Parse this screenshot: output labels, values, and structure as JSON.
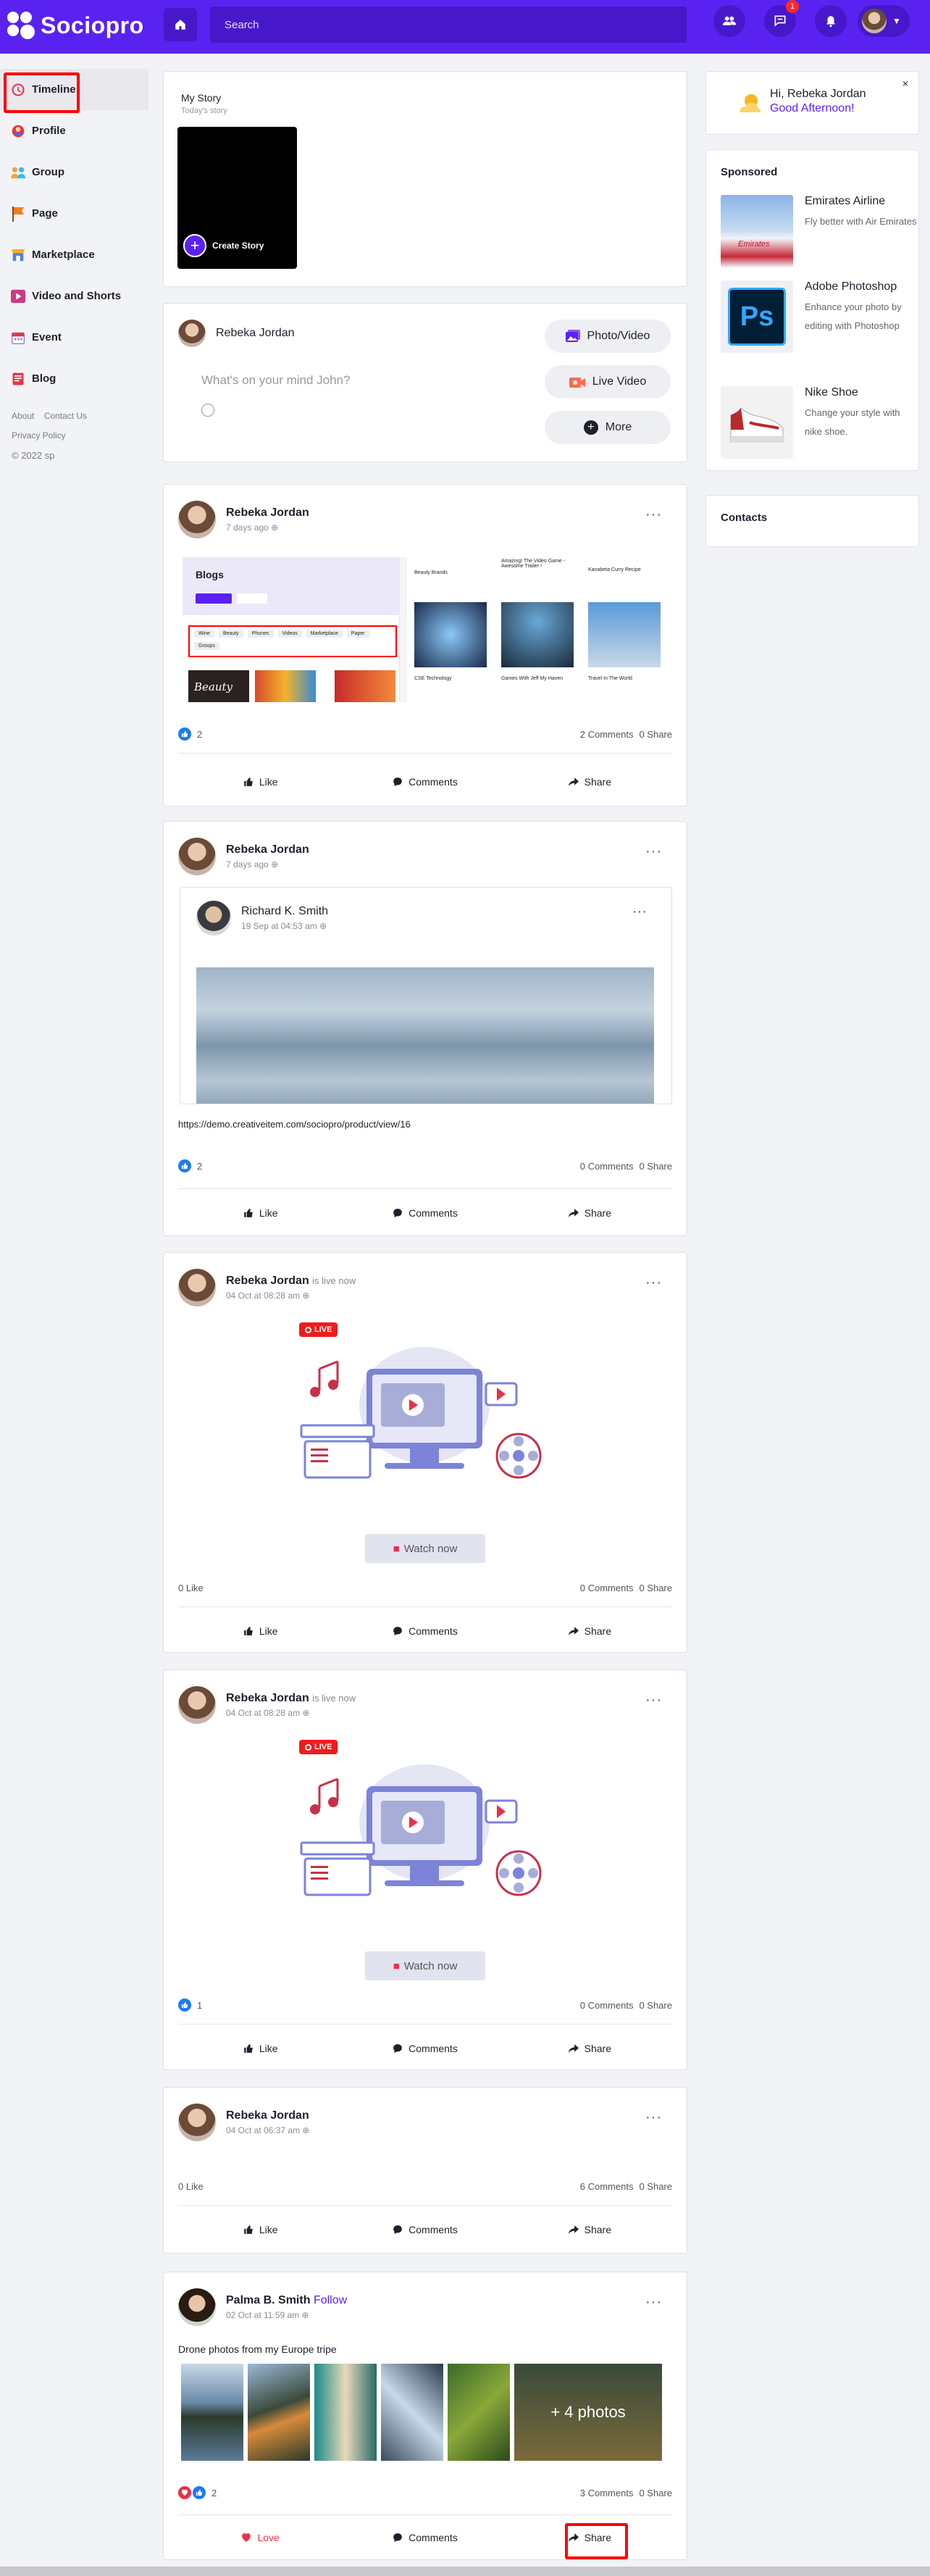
{
  "app": {
    "name": "Sociopro"
  },
  "search": {
    "placeholder": "Search"
  },
  "notifications": {
    "messages_count": "1"
  },
  "sidebar": {
    "items": [
      {
        "label": "Timeline"
      },
      {
        "label": "Profile"
      },
      {
        "label": "Group"
      },
      {
        "label": "Page"
      },
      {
        "label": "Marketplace"
      },
      {
        "label": "Video and Shorts"
      },
      {
        "label": "Event"
      },
      {
        "label": "Blog"
      }
    ],
    "links": {
      "about": "About",
      "contact": "Contact Us",
      "privacy": "Privacy Policy",
      "copyright": "© 2022 sp"
    }
  },
  "story": {
    "title": "My Story",
    "subtitle": "Today's story",
    "create_label": "Create Story"
  },
  "composer": {
    "user": "Rebeka Jordan",
    "placeholder": "What's on your mind John?",
    "photo_label": "Photo/Video",
    "live_label": "Live Video",
    "more_label": "More"
  },
  "posts": [
    {
      "user": "Rebeka Jordan",
      "time": "7 days ago",
      "likes": "2",
      "comments": "2 Comments",
      "shares": "0 Share"
    },
    {
      "user": "Rebeka Jordan",
      "time": "7 days ago",
      "shared_user": "Richard K. Smith",
      "shared_time": "19 Sep at 04:53 am",
      "link": "https://demo.creativeitem.com/sociopro/product/view/16",
      "likes": "2",
      "comments": "0 Comments",
      "shares": "0 Share"
    },
    {
      "user": "Rebeka Jordan",
      "status": "is live now",
      "time": "04 Oct at 08:28 am",
      "live": "LIVE",
      "watch": "Watch now",
      "likes": "0 Like",
      "comments": "0 Comments",
      "shares": "0 Share"
    },
    {
      "user": "Rebeka Jordan",
      "status": "is live now",
      "time": "04 Oct at 08:28 am",
      "live": "LIVE",
      "watch": "Watch now",
      "likes": "1",
      "comments": "0 Comments",
      "shares": "0 Share"
    },
    {
      "user": "Rebeka Jordan",
      "time": "04 Oct at 06:37 am",
      "likes": "0 Like",
      "comments": "6 Comments",
      "shares": "0 Share"
    },
    {
      "user": "Palma B. Smith",
      "follow": "Follow",
      "time": "02 Oct at 11:59 am",
      "text": "Drone photos from my Europe tripe",
      "more_photos": "+ 4 photos",
      "likes": "2",
      "comments": "3 Comments",
      "shares": "0 Share"
    }
  ],
  "actions": {
    "like": "Like",
    "love": "Love",
    "comments": "Comments",
    "share": "Share"
  },
  "blog_preview": {
    "heading": "Blogs",
    "tags": [
      "Wine",
      "Beauty",
      "Phones",
      "Videos",
      "Marketplace",
      "Paper",
      "Groups"
    ],
    "card_titles": [
      "Beauty Brands",
      "Amazing! The Video Game - Awesome Trailer !",
      "Kanabeta Curry Recipe",
      "CSE Technology",
      "Games With Jeff My Haven",
      "Travel In The World"
    ],
    "script": "Beauty"
  },
  "greeting": {
    "hello": "Hi, Rebeka Jordan",
    "message": "Good Afternoon!"
  },
  "sponsored": {
    "heading": "Sponsored",
    "items": [
      {
        "title": "Emirates Airline",
        "desc": "Fly better with Air Emirates",
        "img_text": "Emirates"
      },
      {
        "title": "Adobe Photoshop",
        "desc": "Enhance your photo by editing with Photoshop",
        "img_text": "Ps"
      },
      {
        "title": "Nike Shoe",
        "desc": "Change your style with nike shoe."
      }
    ]
  },
  "contacts": {
    "heading": "Contacts"
  },
  "colors": {
    "brand": "#5a22f0",
    "like": "#1c7bf5",
    "love": "#e8304a",
    "live": "#ee1c1c"
  }
}
